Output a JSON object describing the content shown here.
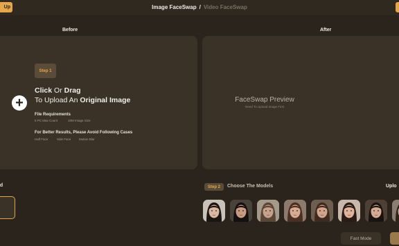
{
  "header": {
    "left_button_label": "Up",
    "tab_image": "Image FaceSwap",
    "separator": "/",
    "tab_video": "Video FaceSwap"
  },
  "before": {
    "label": "Before",
    "step_badge": "Step 1",
    "upload_click": "Click",
    "upload_or": " Or ",
    "upload_drag": "Drag",
    "upload_to": "To Upload An ",
    "upload_original": "Original Image",
    "file_requirements_title": "File Requirements",
    "req_count": "5 PC Max Count",
    "req_size": "10M Image Size",
    "better_results_title": "For Better Results, Please Avoid Following Cases",
    "case_half_face": "Half Face",
    "case_side_face": "Side Face",
    "case_motion_blur": "Motion Blur"
  },
  "after": {
    "label": "After",
    "preview_title": "FaceSwap Preview",
    "preview_sub": "Need To Upload Image First"
  },
  "bottom": {
    "left_fragment": "ed",
    "step2_badge": "Step 2",
    "choose_models": "Choose The Models",
    "upload_fragment": "Uplo",
    "fast_mode": "Fast Mode"
  },
  "models": [
    {
      "name": "model-1",
      "skin": "#d9b8a2",
      "hair": "#1c1612",
      "bg": "#c9c2b8"
    },
    {
      "name": "model-2",
      "skin": "#c79a82",
      "hair": "#141010",
      "bg": "#4a423a"
    },
    {
      "name": "model-3",
      "skin": "#c6a28c",
      "hair": "#5a4636",
      "bg": "#a5998a"
    },
    {
      "name": "model-4",
      "skin": "#d7ab92",
      "hair": "#4a2f22",
      "bg": "#8c7a6c"
    },
    {
      "name": "model-5",
      "skin": "#d1a58b",
      "hair": "#3e2a1e",
      "bg": "#6e5e50"
    },
    {
      "name": "model-6",
      "skin": "#e0b39b",
      "hair": "#2a1c14",
      "bg": "#c7b8ab"
    },
    {
      "name": "model-7",
      "skin": "#d4aa92",
      "hair": "#1a1410",
      "bg": "#4e4034"
    },
    {
      "name": "model-8",
      "skin": "#caa38e",
      "hair": "#2e241c",
      "bg": "#8a7e72"
    }
  ],
  "colors": {
    "accent": "#e6a64a",
    "background": "#2a241c",
    "panel": "#3a3227"
  }
}
